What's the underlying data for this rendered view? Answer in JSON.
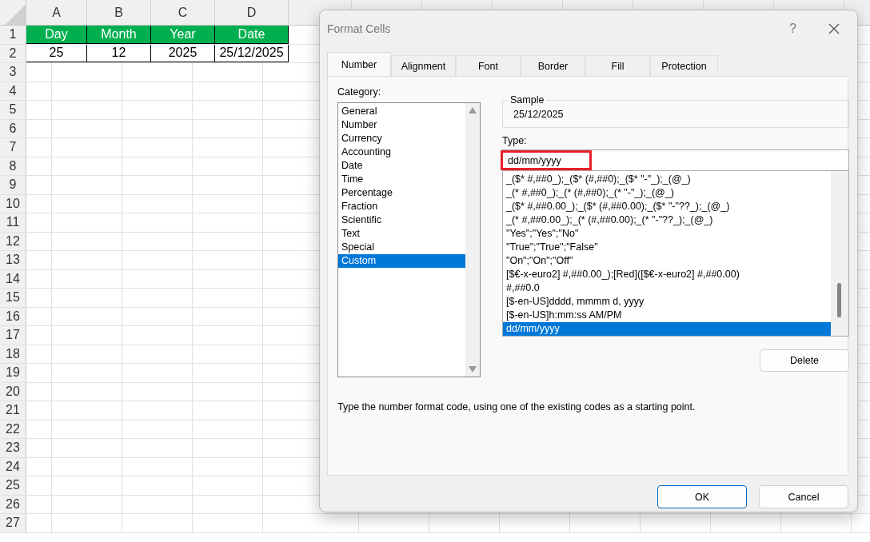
{
  "sheet": {
    "columns": [
      "A",
      "B",
      "C",
      "D"
    ],
    "rows": [
      {
        "number": "1",
        "kind": "header",
        "cells": [
          "Day",
          "Month",
          "Year",
          "Date"
        ]
      },
      {
        "number": "2",
        "kind": "data",
        "cells": [
          "25",
          "12",
          "2025",
          "25/12/2025"
        ]
      },
      {
        "number": "3"
      },
      {
        "number": "4"
      },
      {
        "number": "5"
      },
      {
        "number": "6"
      },
      {
        "number": "7"
      },
      {
        "number": "8"
      },
      {
        "number": "9"
      },
      {
        "number": "10"
      },
      {
        "number": "11"
      },
      {
        "number": "12"
      },
      {
        "number": "13"
      },
      {
        "number": "14"
      },
      {
        "number": "15"
      },
      {
        "number": "16"
      },
      {
        "number": "17"
      },
      {
        "number": "18"
      },
      {
        "number": "19"
      },
      {
        "number": "20"
      },
      {
        "number": "21"
      },
      {
        "number": "22"
      },
      {
        "number": "23"
      },
      {
        "number": "24"
      },
      {
        "number": "25"
      },
      {
        "number": "26"
      },
      {
        "number": "27"
      }
    ]
  },
  "dialog": {
    "title": "Format Cells",
    "help": "?",
    "tabs": [
      {
        "label": "Number",
        "selected": true
      },
      {
        "label": "Alignment",
        "selected": false
      },
      {
        "label": "Font",
        "selected": false
      },
      {
        "label": "Border",
        "selected": false
      },
      {
        "label": "Fill",
        "selected": false
      },
      {
        "label": "Protection",
        "selected": false
      }
    ],
    "category_label": "Category:",
    "categories": [
      {
        "label": "General",
        "selected": false
      },
      {
        "label": "Number",
        "selected": false
      },
      {
        "label": "Currency",
        "selected": false
      },
      {
        "label": "Accounting",
        "selected": false
      },
      {
        "label": "Date",
        "selected": false
      },
      {
        "label": "Time",
        "selected": false
      },
      {
        "label": "Percentage",
        "selected": false
      },
      {
        "label": "Fraction",
        "selected": false
      },
      {
        "label": "Scientific",
        "selected": false
      },
      {
        "label": "Text",
        "selected": false
      },
      {
        "label": "Special",
        "selected": false
      },
      {
        "label": "Custom",
        "selected": true
      }
    ],
    "sample": {
      "label": "Sample",
      "value": "25/12/2025"
    },
    "type_label": "Type:",
    "type_field": {
      "value": "dd/mm/yyyy",
      "highlighted": true
    },
    "formats": [
      {
        "label": "_($* #,##0_);_($* (#,##0);_($* \"-\"_);_(@_)",
        "selected": false
      },
      {
        "label": "_(* #,##0_);_(* (#,##0);_(* \"-\"_);_(@_)",
        "selected": false
      },
      {
        "label": "_($* #,##0.00_);_($* (#,##0.00);_($* \"-\"??_);_(@_)",
        "selected": false
      },
      {
        "label": "_(* #,##0.00_);_(* (#,##0.00);_(* \"-\"??_);_(@_)",
        "selected": false
      },
      {
        "label": "\"Yes\";\"Yes\";\"No\"",
        "selected": false
      },
      {
        "label": "\"True\";\"True\";\"False\"",
        "selected": false
      },
      {
        "label": "\"On\";\"On\";\"Off\"",
        "selected": false
      },
      {
        "label": "[$€-x-euro2] #,##0.00_);[Red]([$€-x-euro2] #,##0.00)",
        "selected": false
      },
      {
        "label": "#,##0.0",
        "selected": false
      },
      {
        "label": "[$-en-US]dddd, mmmm d, yyyy",
        "selected": false
      },
      {
        "label": "[$-en-US]h:mm:ss AM/PM",
        "selected": false
      },
      {
        "label": "dd/mm/yyyy",
        "selected": true
      }
    ],
    "delete_button": "Delete",
    "hint": "Type the number format code, using one of the existing codes as a starting point.",
    "buttons": [
      {
        "label": "OK",
        "kind": "default"
      },
      {
        "label": "Cancel",
        "kind": "normal"
      }
    ]
  }
}
